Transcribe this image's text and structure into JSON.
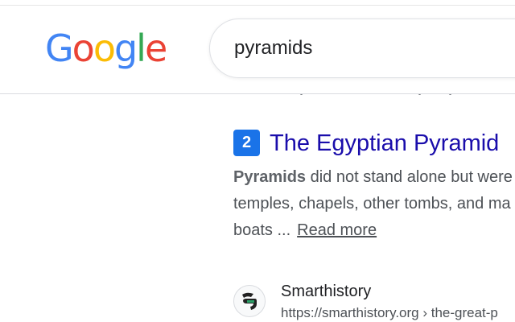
{
  "header": {
    "logo": {
      "letters": [
        "G",
        "o",
        "o",
        "g",
        "l",
        "e"
      ],
      "colors": [
        "#4285F4",
        "#EA4335",
        "#FBBC05",
        "#4285F4",
        "#34A853",
        "#EA4335"
      ]
    },
    "search": {
      "value": "pyramids"
    }
  },
  "result": {
    "rank": "2",
    "title": "The Egyptian Pyramid",
    "snippet": {
      "line1_bold": "Pyramids",
      "line1_rest": " did not stand alone but were",
      "line2": "temples, chapels, other tombs, and ma",
      "line3": "boats ...",
      "read_more": "Read more"
    }
  },
  "source": {
    "site_name": "Smarthistory",
    "url": "https://smarthistory.org › the-great-p",
    "favicon_icon": "smarthistory-icon"
  },
  "colors": {
    "link": "#1a0dab",
    "badge": "#1a73e8",
    "text": "#4d5156"
  }
}
